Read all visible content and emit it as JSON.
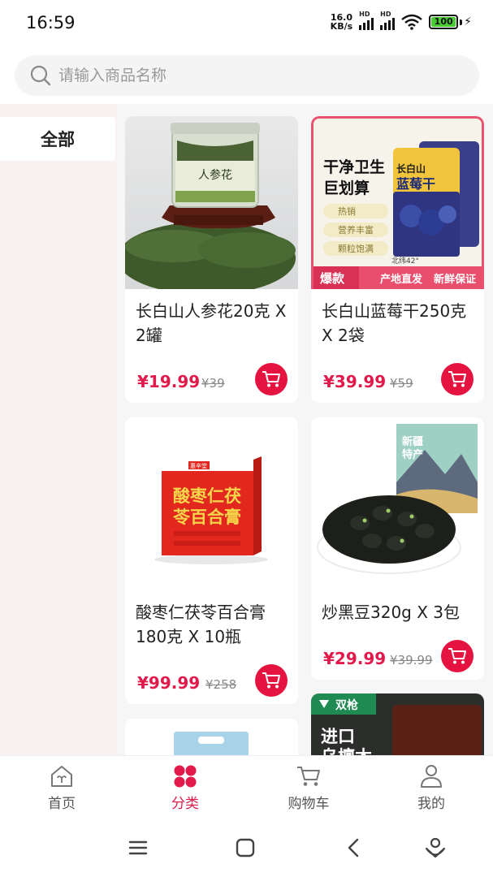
{
  "status_bar": {
    "time": "16:59",
    "net_speed_value": "16.0",
    "net_speed_unit": "KB/s",
    "hd_label": "HD",
    "battery": "100"
  },
  "search": {
    "placeholder": "请输入商品名称"
  },
  "sidebar": {
    "items": [
      {
        "label": "全部",
        "selected": true
      }
    ]
  },
  "products": [
    {
      "title": "长白山人参花20克 X 2罐",
      "price": "¥19.99",
      "original_price": "¥39"
    },
    {
      "title": "长白山蓝莓干250克 X 2袋",
      "price": "¥39.99",
      "original_price": "¥59"
    },
    {
      "title": "酸枣仁茯苓百合膏180克 X 10瓶",
      "price": "¥99.99",
      "original_price": "¥258"
    },
    {
      "title": "炒黑豆320g X 3包",
      "price": "¥29.99",
      "original_price": "¥39.99"
    }
  ],
  "product_images": {
    "ginseng_label": "人参花",
    "blueberry_headline_1": "干净卫生",
    "blueberry_headline_2": "巨划算",
    "blueberry_pack_1": "长白山",
    "blueberry_pack_2": "蓝莓干",
    "blueberry_tags": [
      "热销",
      "营养丰富",
      "颗粒饱满"
    ],
    "blueberry_latitude": "北纬42°",
    "blueberry_badge": "爆款",
    "blueberry_banner_1": "产地直发",
    "blueberry_banner_2": "新鲜保证",
    "suanzaoren_brand": "惠辛堂",
    "suanzaoren_title_1": "酸枣仁茯",
    "suanzaoren_title_2": "苓百合膏",
    "blackbean_tag_1": "新疆",
    "blackbean_tag_2": "特产",
    "partial_brand": "双枪",
    "partial_text": "进口\n乌檀木"
  },
  "bottom_nav": {
    "items": [
      {
        "label": "首页",
        "icon": "home-icon",
        "active": false
      },
      {
        "label": "分类",
        "icon": "category-icon",
        "active": true
      },
      {
        "label": "购物车",
        "icon": "cart-icon",
        "active": false
      },
      {
        "label": "我的",
        "icon": "profile-icon",
        "active": false
      }
    ]
  },
  "colors": {
    "accent": "#e2194b",
    "cart_button": "#e5133f",
    "sidebar_bg": "#f9f2f3",
    "page_bg": "#f6f6f7"
  }
}
